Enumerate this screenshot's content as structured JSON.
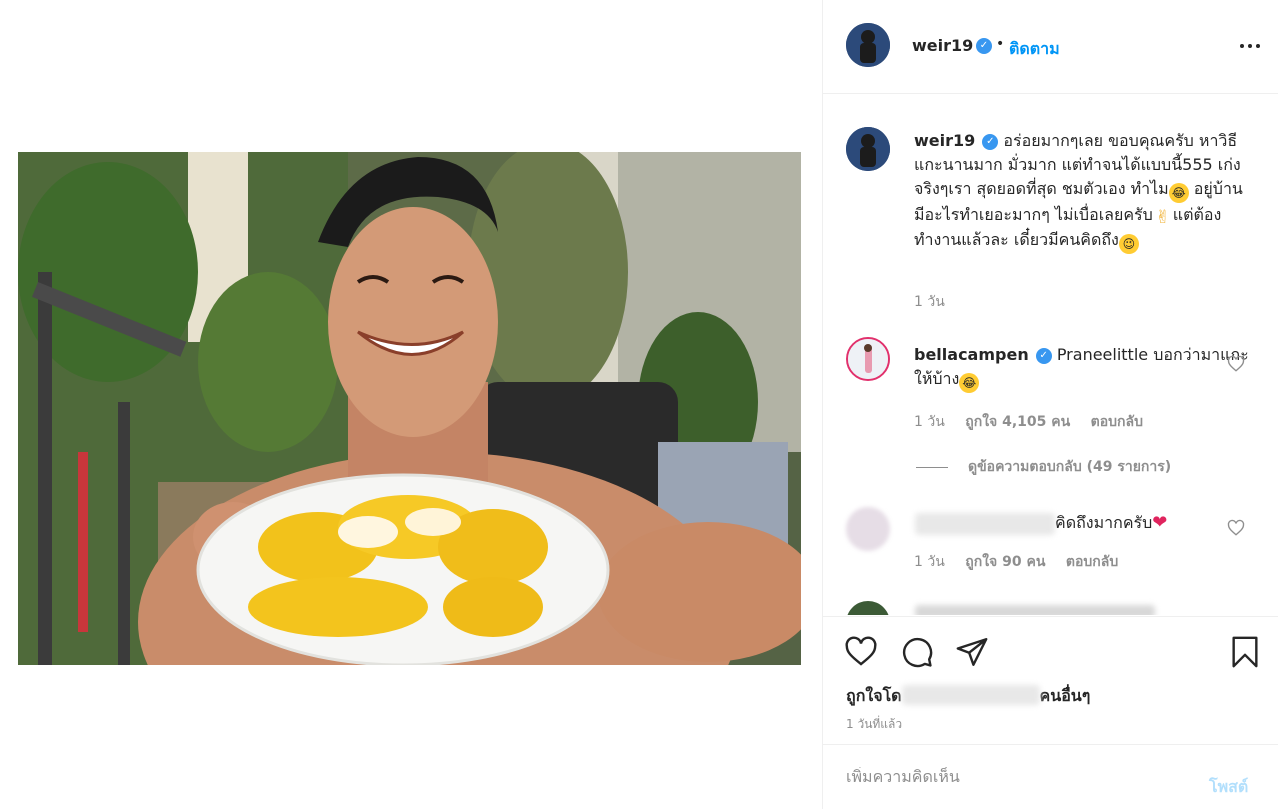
{
  "post": {
    "author": "weir19",
    "follow_label": "ติดตาม",
    "separator": "•",
    "caption": "อร่อยมากๆเลย ขอบคุณครับ หาวิธีแกะนานมาก มั่วมาก แต่ทำจนได้แบบนี้555 เก่งจริงๆเรา สุดยอดที่สุด ชมตัวเอง ทำไม",
    "caption_part2": " อยู่บ้าน มีอะไรทำเยอะมากๆ ไม่เบื่อเลยครับ",
    "caption_part3": "แต่ต้องทำงานแล้วละ เดี๋ยวมีคนคิดถึง",
    "caption_time": "1 วัน",
    "verified_mark": "✓"
  },
  "comments": [
    {
      "username": "bellacampen",
      "text": "Praneelittle บอกว่ามาแกะให้บ้าง",
      "time": "1 วัน",
      "likes": "ถูกใจ 4,105 คน",
      "reply_label": "ตอบกลับ",
      "view_replies": "ดูข้อความตอบกลับ (49 รายการ)"
    },
    {
      "text": "คิดถึงมากครับ",
      "time": "1 วัน",
      "likes": "ถูกใจ 90 คน",
      "reply_label": "ตอบกลับ"
    }
  ],
  "footer": {
    "likes_prefix": "ถูกใจโด",
    "likes_suffix": "คนอื่นๆ",
    "time": "1 วันที่แล้ว",
    "comment_placeholder": "เพิ่มความคิดเห็น",
    "post_label": "โพสต์"
  },
  "icons": {
    "more": "more-horizontal-icon",
    "heart": "heart-icon",
    "comment": "comment-icon",
    "share": "share-icon",
    "save": "bookmark-icon"
  },
  "colors": {
    "accent": "#0095f6",
    "verified": "#3897f0",
    "muted": "#8e8e8e",
    "post_disabled": "#b2dffc"
  }
}
